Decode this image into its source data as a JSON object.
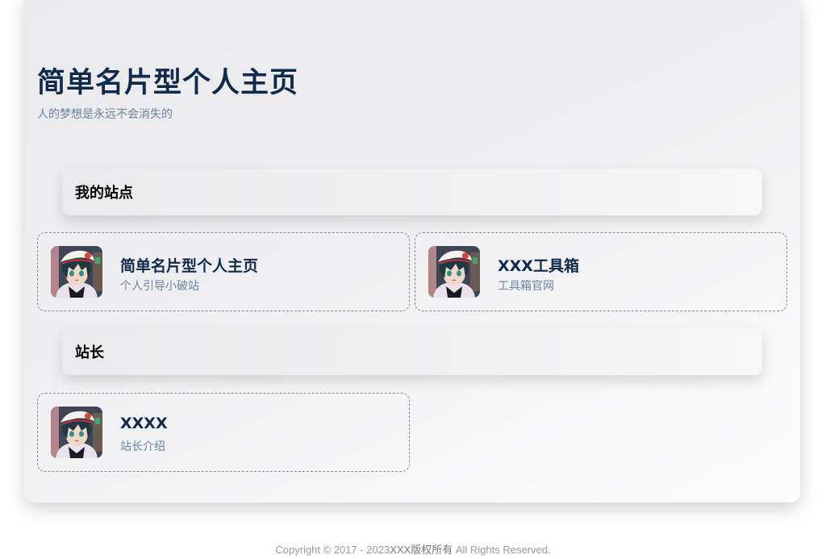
{
  "hero": {
    "title": "简单名片型个人主页",
    "subtitle": "人的梦想是永远不会消失的",
    "avatar_icon": "anime-avatar"
  },
  "sections": [
    {
      "title": "我的站点",
      "items": [
        {
          "name": "简单名片型个人主页",
          "desc": "个人引导小破站",
          "icon": "anime-avatar"
        },
        {
          "name": "XXX工具箱",
          "desc": "工具箱官网",
          "icon": "anime-avatar"
        }
      ]
    },
    {
      "title": "站长",
      "items": [
        {
          "name": "XXXX",
          "desc": "站长介绍",
          "icon": "anime-avatar"
        }
      ]
    }
  ],
  "footer": {
    "copyright_prefix": "Copyright © 2017 - 2023",
    "owner": "XXX版权所有",
    "rights": " All Rights Reserved."
  },
  "colors": {
    "title": "#0f2a4a",
    "subtitle": "#6a85a3",
    "card_border": "#8b8b8b"
  }
}
